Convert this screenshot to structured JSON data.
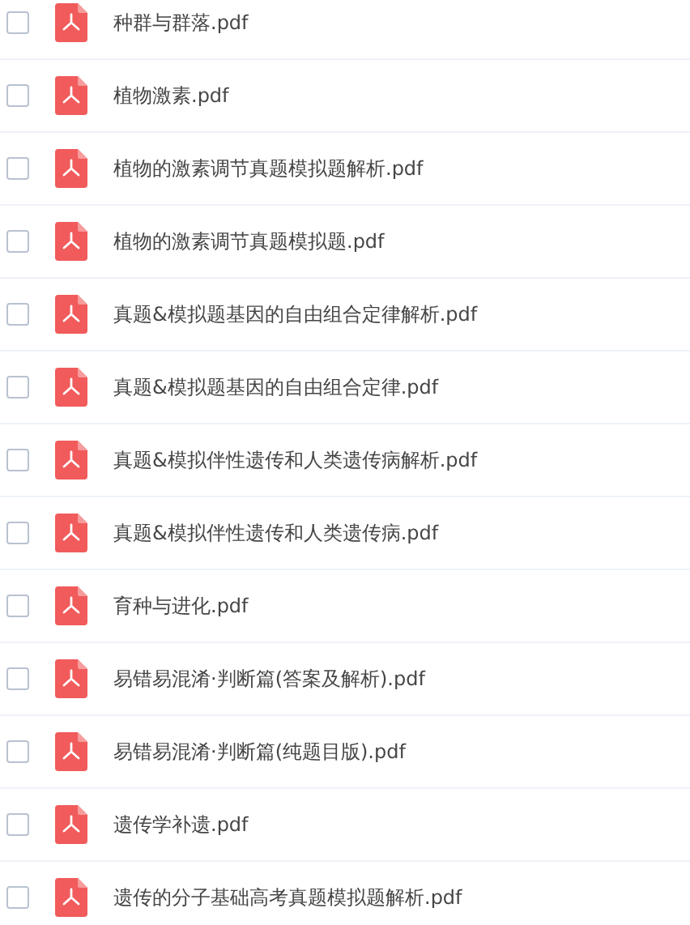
{
  "files": [
    {
      "name": "种群与群落.pdf",
      "checked": false
    },
    {
      "name": "植物激素.pdf",
      "checked": false
    },
    {
      "name": "植物的激素调节真题模拟题解析.pdf",
      "checked": false
    },
    {
      "name": "植物的激素调节真题模拟题.pdf",
      "checked": false
    },
    {
      "name": "真题&模拟题基因的自由组合定律解析.pdf",
      "checked": false
    },
    {
      "name": "真题&模拟题基因的自由组合定律.pdf",
      "checked": false
    },
    {
      "name": "真题&模拟伴性遗传和人类遗传病解析.pdf",
      "checked": false
    },
    {
      "name": "真题&模拟伴性遗传和人类遗传病.pdf",
      "checked": false
    },
    {
      "name": "育种与进化.pdf",
      "checked": false
    },
    {
      "name": "易错易混淆·判断篇(答案及解析).pdf",
      "checked": false
    },
    {
      "name": "易错易混淆·判断篇(纯题目版).pdf",
      "checked": false
    },
    {
      "name": "遗传学补遗.pdf",
      "checked": false
    },
    {
      "name": "遗传的分子基础高考真题模拟题解析.pdf",
      "checked": false
    }
  ]
}
